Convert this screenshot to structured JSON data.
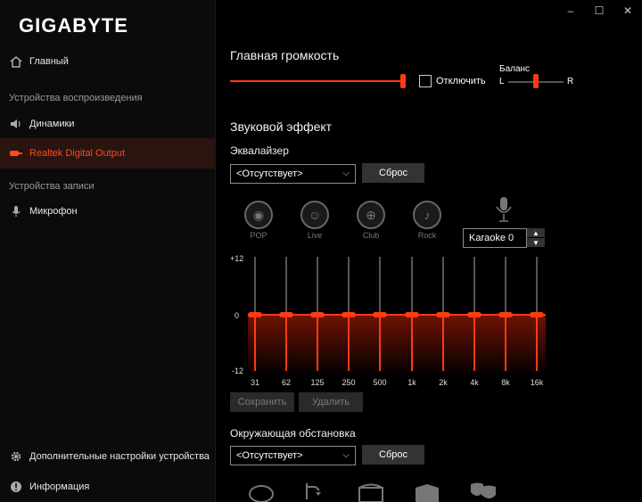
{
  "window": {
    "minimize": "–",
    "maximize": "☐",
    "close": "✕"
  },
  "brand": "GIGABYTE",
  "sidebar": {
    "home": "Главный",
    "playback_section": "Устройства воспроизведения",
    "speakers": "Динамики",
    "digital_output": "Realtek Digital Output",
    "record_section": "Устройства записи",
    "microphone": "Микрофон",
    "advanced": "Дополнительные настройки устройства",
    "info": "Информация"
  },
  "main_volume": {
    "title": "Главная громкость",
    "mute_label": "Отключить",
    "balance_title": "Баланс",
    "balance_left": "L",
    "balance_right": "R",
    "volume_level": 0.99,
    "balance_level": 0.5
  },
  "sound_effect": {
    "title": "Звуковой эффект",
    "eq_title": "Эквалайзер",
    "preset_value": "<Отсутствует>",
    "reset": "Сброс",
    "presets": [
      "POP",
      "Live",
      "Club",
      "Rock"
    ],
    "karaoke_value": "Karaoke 0",
    "y_top": "+12",
    "y_mid": "0",
    "y_bottom": "-12",
    "bands": [
      "31",
      "62",
      "125",
      "250",
      "500",
      "1k",
      "2k",
      "4k",
      "8k",
      "16k"
    ],
    "save": "Сохранить",
    "delete": "Удалить"
  },
  "environment": {
    "title": "Окружающая обстановка",
    "preset_value": "<Отсутствует>",
    "reset": "Сброс"
  },
  "colors": {
    "accent": "#ff3b12",
    "active_bg": "#2a1410"
  }
}
